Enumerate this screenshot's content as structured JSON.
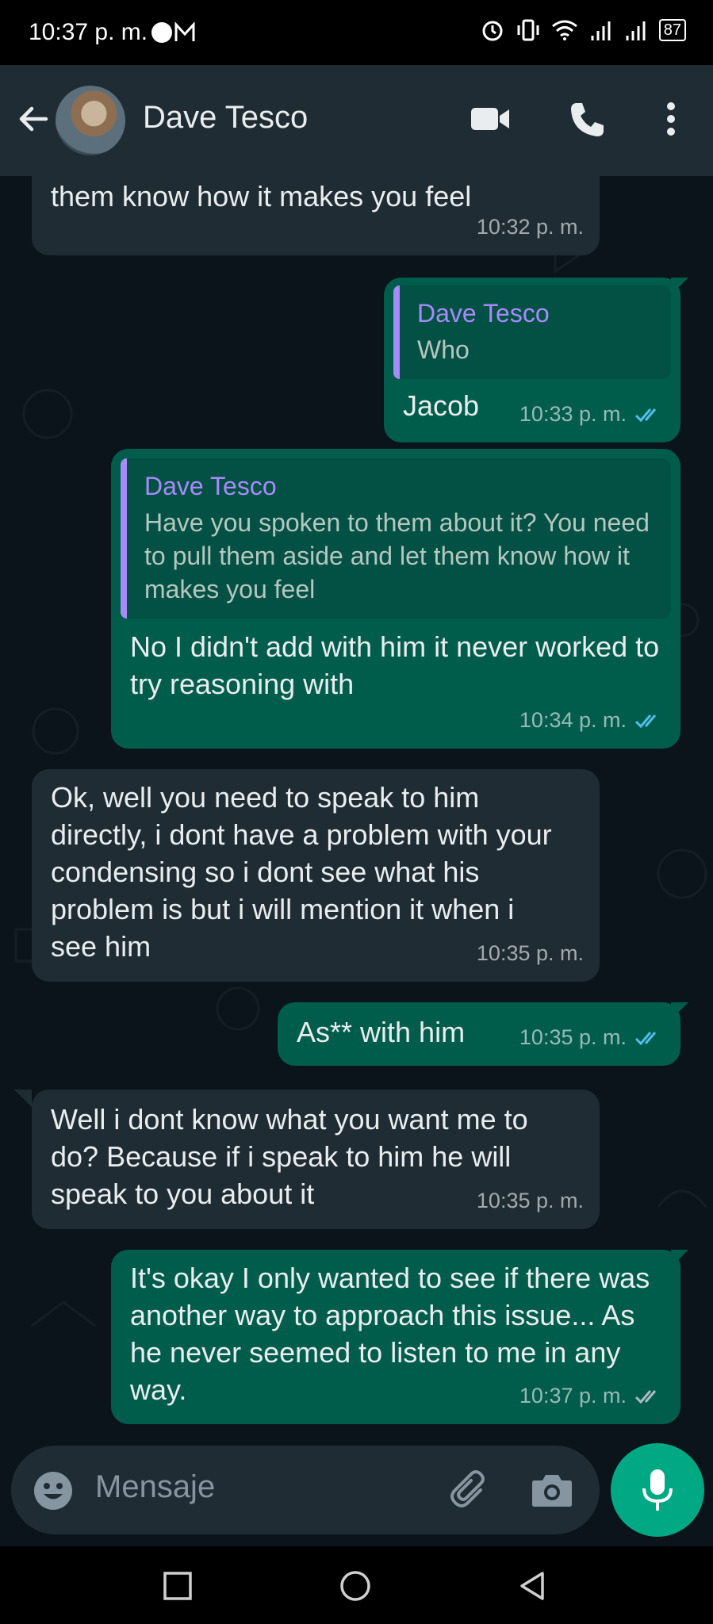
{
  "status_bar": {
    "time": "10:37 p. m.",
    "battery": "87"
  },
  "header": {
    "contact_name": "Dave Tesco",
    "icons": [
      "back-arrow-icon",
      "video-call-icon",
      "phone-icon",
      "more-vert-icon"
    ]
  },
  "messages": [
    {
      "dir": "in",
      "text": "them know how it makes you feel",
      "time": "10:32 p. m."
    },
    {
      "dir": "out",
      "quote_author": "Dave Tesco",
      "quote_text": "Who",
      "text": "Jacob",
      "time": "10:33 p. m.",
      "status": "read"
    },
    {
      "dir": "out",
      "quote_author": "Dave Tesco",
      "quote_text": "Have you spoken to them about it? You need to pull them aside and let them know how it makes you feel",
      "text": "No I didn't add with him it never worked to try reasoning with",
      "time": "10:34 p. m.",
      "status": "read"
    },
    {
      "dir": "in",
      "text": "Ok, well you need to speak to him directly, i dont have a problem with your condensing so i dont see what his problem is but i will mention it when i see him",
      "time": "10:35 p. m."
    },
    {
      "dir": "out",
      "text": "As** with him",
      "time": "10:35 p. m.",
      "status": "read"
    },
    {
      "dir": "in",
      "text": "Well i dont know what you want me to do? Because if i speak to him he will speak to you about it",
      "time": "10:35 p. m."
    },
    {
      "dir": "out",
      "text": "It's okay I only wanted to see if there was another way to approach this issue... As he never seemed to listen to me in any way.",
      "time": "10:37 p. m.",
      "status": "delivered"
    }
  ],
  "composer": {
    "placeholder": "Mensaje"
  },
  "colors": {
    "background": "#0b141a",
    "header": "#202c33",
    "incoming": "#202c33",
    "outgoing": "#005c4b",
    "accent": "#00a884",
    "quote_author": "#a78bfa",
    "read_check": "#53bdeb"
  }
}
